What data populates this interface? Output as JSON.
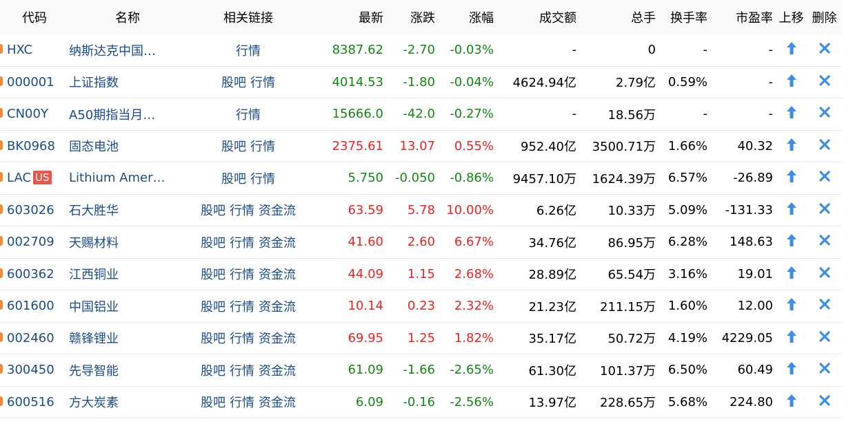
{
  "columns": {
    "code": "代码",
    "name": "名称",
    "links": "相关链接",
    "price": "最新",
    "change": "涨跌",
    "pct": "涨幅",
    "amount": "成交额",
    "volume": "总手",
    "turnover": "换手率",
    "pe": "市盈率",
    "move_up": "上移",
    "delete": "删除"
  },
  "colors": {
    "up": "#ee2222",
    "down": "#118811",
    "link": "#1a4b8c",
    "icon": "#3a8ee6"
  },
  "rows": [
    {
      "code": "HXC",
      "badge": "",
      "name": "纳斯达克中国…",
      "links": [
        "行情"
      ],
      "price": "8387.62",
      "change": "-2.70",
      "pct": "-0.03%",
      "amount": "-",
      "volume": "0",
      "turnover": "-",
      "pe": "-",
      "trend": "down"
    },
    {
      "code": "000001",
      "badge": "",
      "name": "上证指数",
      "links": [
        "股吧",
        "行情"
      ],
      "price": "4014.53",
      "change": "-1.80",
      "pct": "-0.04%",
      "amount": "4624.94亿",
      "volume": "2.79亿",
      "turnover": "0.59%",
      "pe": "-",
      "trend": "down"
    },
    {
      "code": "CN00Y",
      "badge": "",
      "name": "A50期指当月…",
      "links": [
        "行情"
      ],
      "price": "15666.0",
      "change": "-42.0",
      "pct": "-0.27%",
      "amount": "-",
      "volume": "18.56万",
      "turnover": "-",
      "pe": "-",
      "trend": "down"
    },
    {
      "code": "BK0968",
      "badge": "",
      "name": "固态电池",
      "links": [
        "股吧",
        "行情"
      ],
      "price": "2375.61",
      "change": "13.07",
      "pct": "0.55%",
      "amount": "952.40亿",
      "volume": "3500.71万",
      "turnover": "1.66%",
      "pe": "40.32",
      "trend": "up"
    },
    {
      "code": "LAC",
      "badge": "US",
      "name": "Lithium Amer…",
      "links": [
        "股吧",
        "行情"
      ],
      "price": "5.750",
      "change": "-0.050",
      "pct": "-0.86%",
      "amount": "9457.10万",
      "volume": "1624.39万",
      "turnover": "6.57%",
      "pe": "-26.89",
      "trend": "down"
    },
    {
      "code": "603026",
      "badge": "",
      "name": "石大胜华",
      "links": [
        "股吧",
        "行情",
        "资金流"
      ],
      "price": "63.59",
      "change": "5.78",
      "pct": "10.00%",
      "amount": "6.26亿",
      "volume": "10.33万",
      "turnover": "5.09%",
      "pe": "-131.33",
      "trend": "up"
    },
    {
      "code": "002709",
      "badge": "",
      "name": "天赐材料",
      "links": [
        "股吧",
        "行情",
        "资金流"
      ],
      "price": "41.60",
      "change": "2.60",
      "pct": "6.67%",
      "amount": "34.76亿",
      "volume": "86.95万",
      "turnover": "6.28%",
      "pe": "148.63",
      "trend": "up"
    },
    {
      "code": "600362",
      "badge": "",
      "name": "江西铜业",
      "links": [
        "股吧",
        "行情",
        "资金流"
      ],
      "price": "44.09",
      "change": "1.15",
      "pct": "2.68%",
      "amount": "28.89亿",
      "volume": "65.54万",
      "turnover": "3.16%",
      "pe": "19.01",
      "trend": "up"
    },
    {
      "code": "601600",
      "badge": "",
      "name": "中国铝业",
      "links": [
        "股吧",
        "行情",
        "资金流"
      ],
      "price": "10.14",
      "change": "0.23",
      "pct": "2.32%",
      "amount": "21.23亿",
      "volume": "211.15万",
      "turnover": "1.60%",
      "pe": "12.00",
      "trend": "up"
    },
    {
      "code": "002460",
      "badge": "",
      "name": "赣锋锂业",
      "links": [
        "股吧",
        "行情",
        "资金流"
      ],
      "price": "69.95",
      "change": "1.25",
      "pct": "1.82%",
      "amount": "35.17亿",
      "volume": "50.72万",
      "turnover": "4.19%",
      "pe": "4229.05",
      "trend": "up"
    },
    {
      "code": "300450",
      "badge": "",
      "name": "先导智能",
      "links": [
        "股吧",
        "行情",
        "资金流"
      ],
      "price": "61.09",
      "change": "-1.66",
      "pct": "-2.65%",
      "amount": "61.30亿",
      "volume": "101.37万",
      "turnover": "6.50%",
      "pe": "60.49",
      "trend": "down"
    },
    {
      "code": "600516",
      "badge": "",
      "name": "方大炭素",
      "links": [
        "股吧",
        "行情",
        "资金流"
      ],
      "price": "6.09",
      "change": "-0.16",
      "pct": "-2.56%",
      "amount": "13.97亿",
      "volume": "228.65万",
      "turnover": "5.68%",
      "pe": "224.80",
      "trend": "down"
    }
  ]
}
